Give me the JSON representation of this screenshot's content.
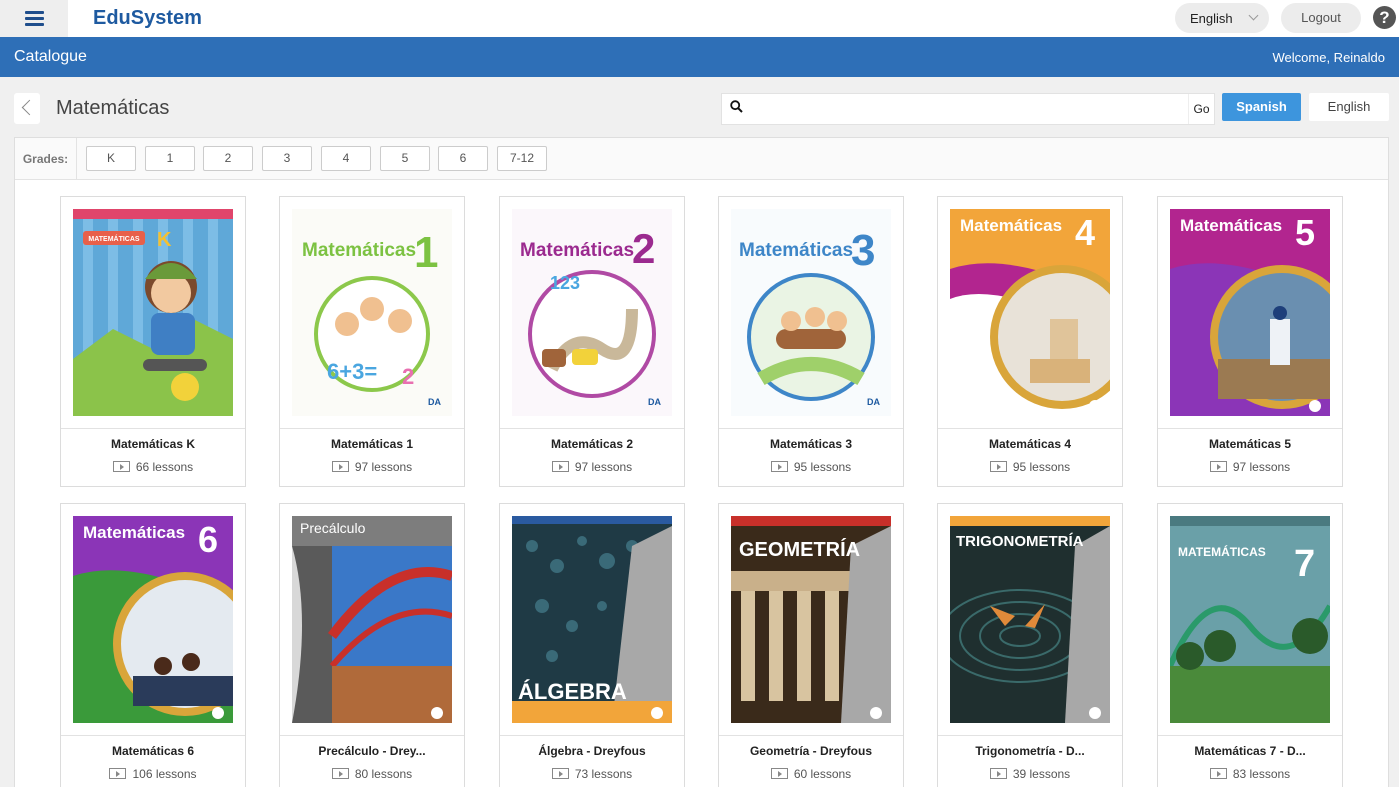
{
  "app": {
    "brand": "EduSystem",
    "language_select": "English",
    "logout_label": "Logout",
    "help_label": "?"
  },
  "band": {
    "breadcrumb": "Catalogue",
    "welcome": "Welcome, Reinaldo"
  },
  "header": {
    "title": "Matemáticas",
    "search_placeholder": "",
    "go_label": "Go",
    "spanish_label": "Spanish",
    "english_label": "English"
  },
  "grades": {
    "label": "Grades:",
    "items": [
      "K",
      "1",
      "2",
      "3",
      "4",
      "5",
      "6",
      "7-12"
    ]
  },
  "colors": {
    "brand_blue": "#1e5aa0",
    "band_blue": "#2e6fb7",
    "active_button": "#3d95dd"
  },
  "courses": [
    {
      "title": "Matemáticas K",
      "lessons": "66 lessons",
      "cover_text": "MATEMÁTICAS",
      "cover_number": "K"
    },
    {
      "title": "Matemáticas 1",
      "lessons": "97 lessons",
      "cover_text": "Matemáticas",
      "cover_number": "1"
    },
    {
      "title": "Matemáticas 2",
      "lessons": "97 lessons",
      "cover_text": "Matemáticas",
      "cover_number": "2"
    },
    {
      "title": "Matemáticas 3",
      "lessons": "95 lessons",
      "cover_text": "Matemáticas",
      "cover_number": "3"
    },
    {
      "title": "Matemáticas 4",
      "lessons": "95 lessons",
      "cover_text": "Matemáticas",
      "cover_number": "4"
    },
    {
      "title": "Matemáticas 5",
      "lessons": "97 lessons",
      "cover_text": "Matemáticas",
      "cover_number": "5"
    },
    {
      "title": "Matemáticas 6",
      "lessons": "106 lessons",
      "cover_text": "Matemáticas",
      "cover_number": "6"
    },
    {
      "title": "Precálculo - Drey...",
      "lessons": "80 lessons",
      "cover_text": "Precálculo",
      "cover_number": ""
    },
    {
      "title": "Álgebra - Dreyfous",
      "lessons": "73 lessons",
      "cover_text": "ÁLGEBRA",
      "cover_number": ""
    },
    {
      "title": "Geometría - Dreyfous",
      "lessons": "60 lessons",
      "cover_text": "GEOMETRÍA",
      "cover_number": ""
    },
    {
      "title": "Trigonometría - D...",
      "lessons": "39 lessons",
      "cover_text": "TRIGONOMETRÍA",
      "cover_number": ""
    },
    {
      "title": "Matemáticas 7 - D...",
      "lessons": "83 lessons",
      "cover_text": "MATEMÁTICAS",
      "cover_number": "7"
    }
  ]
}
